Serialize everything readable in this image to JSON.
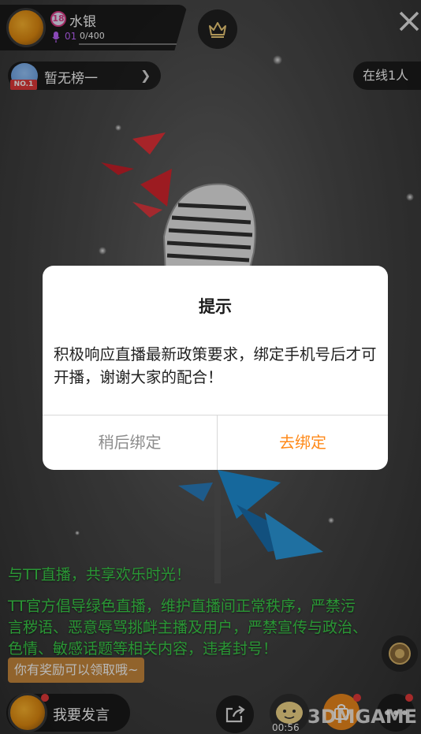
{
  "host": {
    "level_badge": "18",
    "name": "水银",
    "mic_level": "01",
    "progress_text": "0/400",
    "progress_fraction": 0.0
  },
  "rank": {
    "tag": "NO.1",
    "label": "暂无榜一"
  },
  "online": {
    "label": "在线1人"
  },
  "dialog": {
    "title": "提示",
    "message": "积极响应直播最新政策要求，绑定手机号后才可开播，谢谢大家的配合！",
    "cancel_label": "稍后绑定",
    "confirm_label": "去绑定"
  },
  "chat": {
    "welcome": "与TT直播，共享欢乐时光！",
    "notice": "TT官方倡导绿色直播，维护直播间正常秩序，严禁污言秽语、恶意辱骂挑衅主播及用户，严禁宣传与政治、色情、敏感话题等相关内容，违者封号！"
  },
  "reward_tip": "你有奖励可以领取哦~",
  "bottom_bar": {
    "speak_label": "我要发言",
    "gift_timer": "00:56"
  },
  "watermark": "3DMGAME",
  "colors": {
    "dialog_confirm": "#ff8a1a",
    "dialog_cancel": "#8c8c8c",
    "chat_green": "#3bd14a",
    "reward_bg": "#c9893d",
    "level_purple": "#c066ff"
  },
  "icons": [
    "crown-icon",
    "close-icon",
    "chevron-right-icon",
    "mic-icon",
    "share-icon",
    "gift-icon",
    "more-icon",
    "badge-icon"
  ]
}
